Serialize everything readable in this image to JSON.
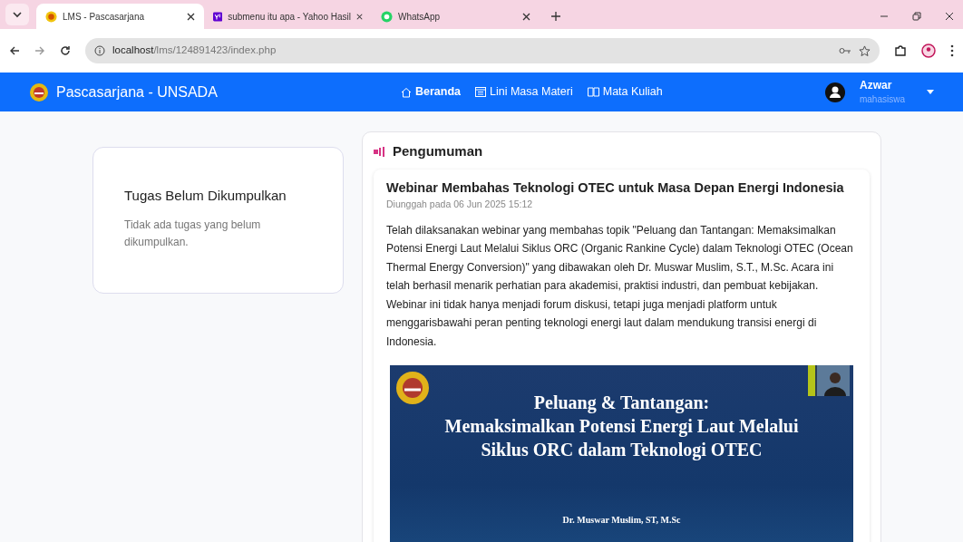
{
  "browser": {
    "tabs": [
      {
        "title": "LMS - Pascasarjana",
        "selected": true
      },
      {
        "title": "submenu itu apa - Yahoo Hasil",
        "selected": false
      },
      {
        "title": "WhatsApp",
        "selected": false
      }
    ],
    "address": {
      "host": "localhost",
      "path": "/lms/124891423/index.php"
    }
  },
  "navbar": {
    "brand": "Pascasarjana - UNSADA",
    "links": [
      {
        "label": "Beranda",
        "selected": true
      },
      {
        "label": "Lini Masa Materi",
        "selected": false
      },
      {
        "label": "Mata Kuliah",
        "selected": false
      }
    ],
    "user": {
      "name": "Azwar",
      "role": "mahasiswa"
    }
  },
  "tasks_card": {
    "title": "Tugas Belum Dikumpulkan",
    "message": "Tidak ada tugas yang belum dikumpulkan."
  },
  "announcements": {
    "title": "Pengumuman",
    "posts": [
      {
        "title": "Webinar Membahas Teknologi OTEC untuk Masa Depan Energi Indonesia",
        "meta": "Diunggah pada 06 Jun 2025 15:12",
        "body": "Telah dilaksanakan webinar yang membahas topik \"Peluang dan Tantangan: Memaksimalkan Potensi Energi Laut Melalui Siklus ORC (Organic Rankine Cycle) dalam Teknologi OTEC (Ocean Thermal Energy Conversion)\" yang dibawakan oleh Dr. Muswar Muslim, S.T., M.Sc. Acara ini telah berhasil menarik perhatian para akademisi, praktisi industri, dan pembuat kebijakan. Webinar ini tidak hanya menjadi forum diskusi, tetapi juga menjadi platform untuk menggarisbawahi peran penting teknologi energi laut dalam mendukung transisi energi di Indonesia.",
        "slide": {
          "title_lines": [
            "Peluang & Tantangan:",
            "Memaksimalkan Potensi Energi Laut Melalui",
            "Siklus ORC dalam Teknologi OTEC"
          ],
          "presenter": "Dr. Muswar Muslim, ST, M.Sc"
        }
      }
    ]
  }
}
